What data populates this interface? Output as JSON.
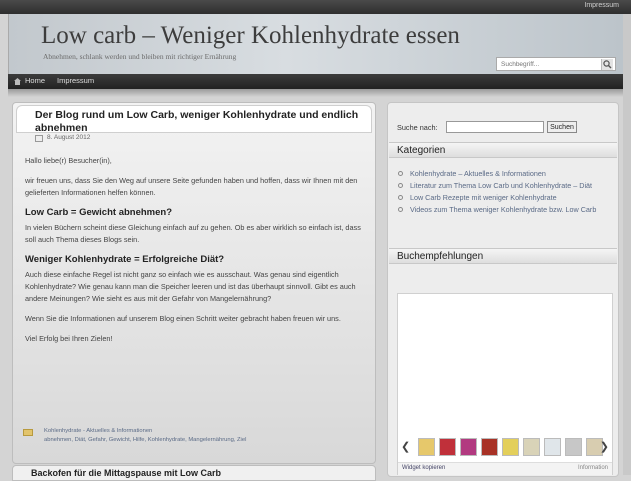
{
  "topbar": {
    "impressum": "Impressum"
  },
  "header": {
    "title": "Low carb – Weniger Kohlenhydrate essen",
    "tagline": "Abnehmen, schlank werden und bleiben mit richtiger Ernährung",
    "search_placeholder": "Suchbegriff..."
  },
  "nav": {
    "items": [
      {
        "label": "Home"
      },
      {
        "label": "Impressum"
      }
    ]
  },
  "post": {
    "title": "Der Blog rund um Low Carb, weniger Kohlenhydrate und endlich abnehmen",
    "date": "8. August 2012",
    "greeting": "Hallo liebe(r) Besucher(in),",
    "intro": "wir freuen uns, dass Sie den Weg auf unsere Seite gefunden haben und hoffen, dass wir Ihnen mit den gelieferten Informationen helfen können.",
    "h1": "Low Carb = Gewicht abnehmen?",
    "p1": "In vielen Büchern scheint diese Gleichung einfach auf zu gehen. Ob es aber wirklich so einfach ist, dass soll auch Thema dieses Blogs sein.",
    "h2": "Weniger Kohlenhydrate = Erfolgreiche Diät?",
    "p2": "Auch diese einfache Regel ist nicht ganz so einfach wie es ausschaut. Was genau sind eigentlich Kohlenhydrate? Wie genau kann man die Speicher leeren und ist das überhaupt sinnvoll. Gibt es auch andere Meinungen? Wie sieht es aus mit der Gefahr von Mangelernährung?",
    "p3": "Wenn Sie die Informationen auf unserem Blog einen Schritt weiter gebracht haben freuen wir uns.",
    "p4": "Viel Erfolg bei Ihren Zielen!",
    "footer_category": "Kohlenhydrate - Aktuelles & Informationen",
    "footer_tags": "abnehmen, Diät, Gefahr, Gewicht, Hilfe, Kohlenhydrate, Mangelernährung, Ziel"
  },
  "next_post": {
    "title": "Backofen für die Mittagspause mit Low Carb"
  },
  "sidebar": {
    "search_label": "Suche nach:",
    "search_button": "Suchen",
    "categories_title": "Kategorien",
    "categories": [
      "Kohlenhydrate – Aktuelles & Informationen",
      "Literatur zum Thema Low Carb und Kohlenhydrate – Diät",
      "Low Carb Rezepte mit weniger Kohlenhydrate",
      "Videos zum Thema weniger Kohlenhydrate bzw. Low Carb"
    ],
    "books_title": "Buchempfehlungen",
    "widget_link": "Widget kopieren",
    "widget_info": "Information",
    "book_colors": [
      "#e6c86b",
      "#c0303a",
      "#b23a80",
      "#a83226",
      "#e3cf5b",
      "#d9d3b8",
      "#e0e6ea",
      "#c7c7c7",
      "#d8cdb0"
    ]
  }
}
